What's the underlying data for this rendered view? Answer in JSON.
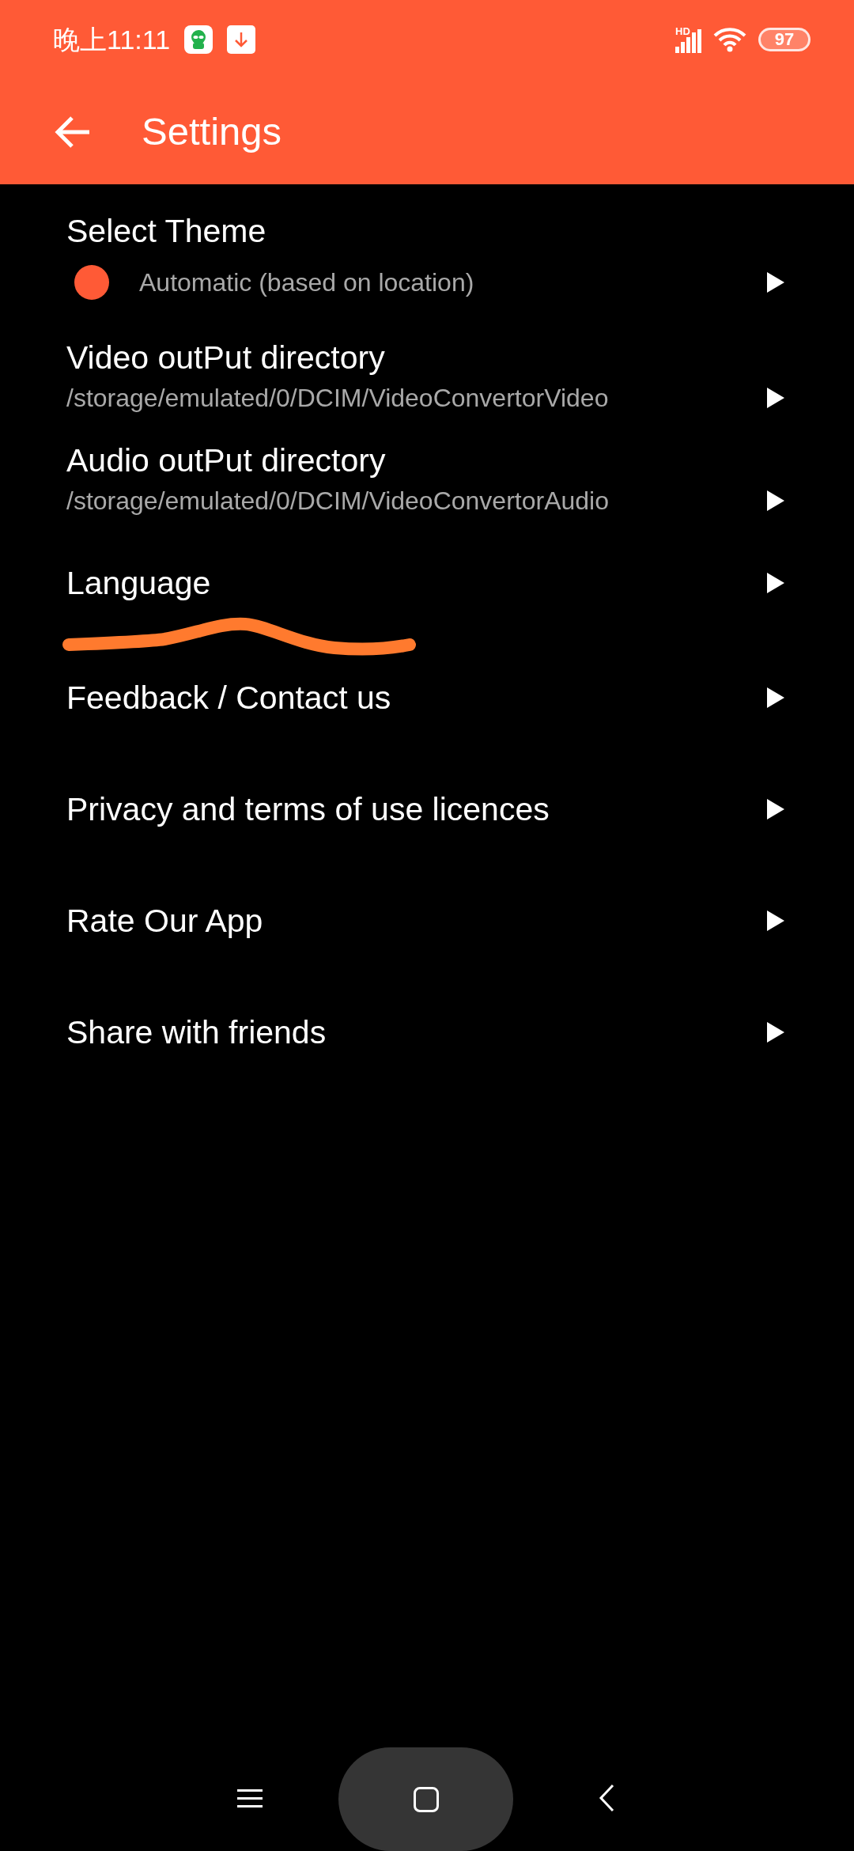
{
  "status_bar": {
    "time": "晚上11:11",
    "network": "HD",
    "battery": "97"
  },
  "toolbar": {
    "title": "Settings"
  },
  "items": [
    {
      "kind": "theme",
      "title": "Select Theme",
      "value": "Automatic (based on location)"
    },
    {
      "kind": "path",
      "title": "Video outPut directory",
      "value": "/storage/emulated/0/DCIM/VideoConvertorVideo"
    },
    {
      "kind": "path",
      "title": "Audio outPut directory",
      "value": "/storage/emulated/0/DCIM/VideoConvertorAudio"
    },
    {
      "kind": "plain",
      "title": "Language",
      "underlined": true
    },
    {
      "kind": "plain",
      "title": "Feedback / Contact us",
      "underlined": false
    },
    {
      "kind": "plain",
      "title": "Privacy and terms of use licences",
      "underlined": false
    },
    {
      "kind": "plain",
      "title": "Rate Our App",
      "underlined": false
    },
    {
      "kind": "plain",
      "title": "Share with friends",
      "underlined": false
    }
  ]
}
